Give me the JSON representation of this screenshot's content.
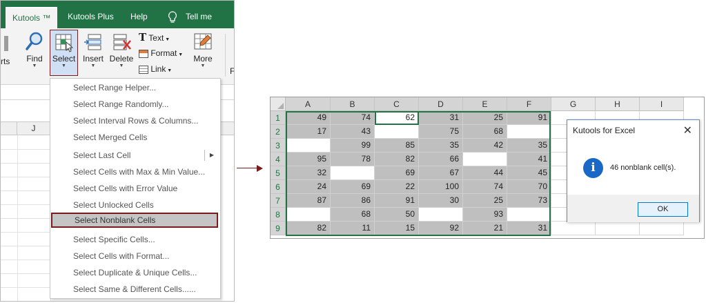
{
  "tabs": {
    "kutools": "Kutools ™",
    "kutools_plus": "Kutools Plus",
    "help": "Help",
    "tell_me": "Tell me what"
  },
  "ribbon": {
    "partial_left": "rts",
    "find": "Find",
    "select": "Select",
    "insert": "Insert",
    "delete": "Delete",
    "text": "Text",
    "format": "Format",
    "link": "Link",
    "more": "More",
    "partial_right": "F"
  },
  "left_sheet": {
    "col_j": "J"
  },
  "menu": {
    "items": [
      "Select Range Helper...",
      "Select Range Randomly...",
      "Select Interval Rows & Columns...",
      "Select Merged Cells",
      "Select Last Cell",
      "Select Cells with Max & Min Value...",
      "Select Cells with Error Value",
      "Select Unlocked Cells",
      "Select Nonblank Cells",
      "Select Specific Cells...",
      "Select Cells with Format...",
      "Select Duplicate & Unique Cells...",
      "Select Same & Different Cells......"
    ],
    "highlighted_index": 8
  },
  "grid": {
    "columns": [
      "A",
      "B",
      "C",
      "D",
      "E",
      "F",
      "G",
      "H",
      "I"
    ],
    "rows": [
      "1",
      "2",
      "3",
      "4",
      "5",
      "6",
      "7",
      "8",
      "9"
    ],
    "data": [
      [
        "49",
        "74",
        "62",
        "31",
        "25",
        "91"
      ],
      [
        "17",
        "43",
        "",
        "75",
        "68",
        ""
      ],
      [
        "",
        "99",
        "85",
        "35",
        "42",
        "35"
      ],
      [
        "95",
        "78",
        "82",
        "66",
        "",
        "41"
      ],
      [
        "32",
        "",
        "69",
        "67",
        "44",
        "45"
      ],
      [
        "24",
        "69",
        "22",
        "100",
        "74",
        "70"
      ],
      [
        "87",
        "86",
        "91",
        "30",
        "25",
        "73"
      ],
      [
        "",
        "68",
        "50",
        "",
        "93",
        ""
      ],
      [
        "82",
        "11",
        "15",
        "92",
        "21",
        "31"
      ]
    ]
  },
  "dialog": {
    "title": "Kutools for Excel",
    "message": "46 nonblank cell(s).",
    "ok": "OK",
    "info_glyph": "i",
    "close_glyph": "✕"
  },
  "colors": {
    "excel_green": "#217346",
    "highlight_border": "#7a1b1b",
    "nonblank_fill": "#bfbfbf",
    "info_blue": "#1967c6"
  }
}
